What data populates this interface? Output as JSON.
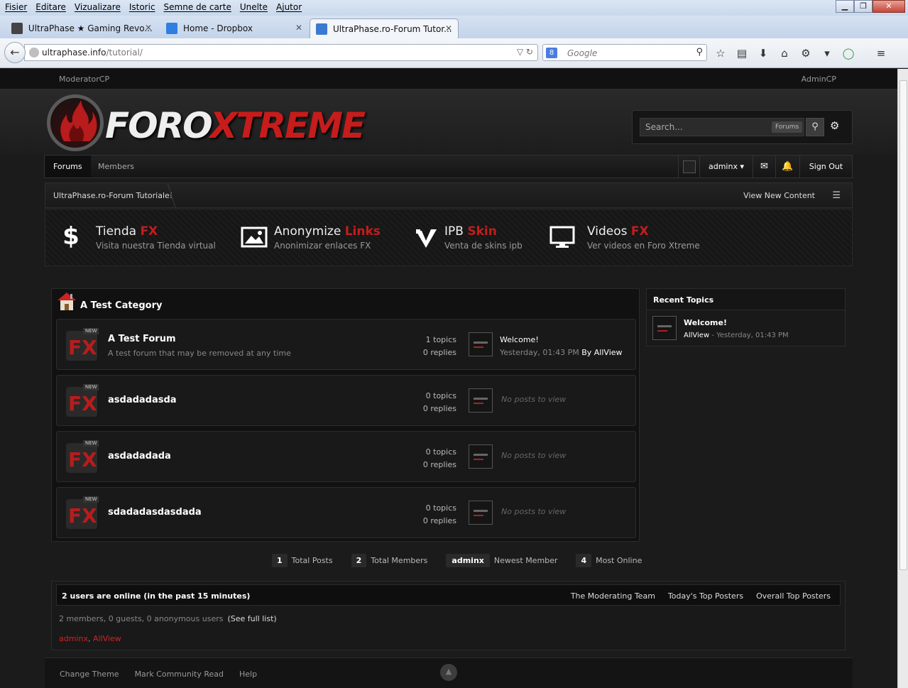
{
  "browser": {
    "menu": [
      "Fisier",
      "Editare",
      "Vizualizare",
      "Istoric",
      "Semne de carte",
      "Unelte",
      "Ajutor"
    ],
    "tabs": [
      {
        "label": "UltraPhase ★ Gaming Revo...",
        "active": false
      },
      {
        "label": "Home - Dropbox",
        "active": false
      },
      {
        "label": "UltraPhase.ro-Forum Tutor...",
        "active": true
      }
    ],
    "url_host": "ultraphase.info",
    "url_path": "/tutorial/",
    "search_placeholder": "Google"
  },
  "site": {
    "top_left": "ModeratorCP",
    "top_right": "AdminCP",
    "logo": {
      "part1": "FORO",
      "part2": "XTREME"
    },
    "search": {
      "placeholder": "Search...",
      "scope": "Forums"
    },
    "nav": {
      "forums": "Forums",
      "members": "Members",
      "username": "adminx",
      "sign_out": "Sign Out"
    },
    "breadcrumb": "UltraPhase.ro-Forum Tutoriale!",
    "view_new_content": "View New Content",
    "promos": [
      {
        "icon": "$",
        "title": "Tienda",
        "accent": "FX",
        "subtitle": "Visita nuestra Tienda virtual"
      },
      {
        "icon": "image",
        "title": "Anonymize",
        "accent": "Links",
        "subtitle": "Anonimizar enlaces FX"
      },
      {
        "icon": "V",
        "title": "IPB",
        "accent": "Skin",
        "subtitle": "Venta de skins ipb"
      },
      {
        "icon": "monitor",
        "title": "Videos",
        "accent": "FX",
        "subtitle": "Ver videos en Foro Xtreme"
      }
    ],
    "category": "A Test Category",
    "forums": [
      {
        "name": "A Test Forum",
        "desc": "A test forum that may be removed at any time",
        "topics": "1 topics",
        "replies": "0 replies",
        "last_title": "Welcome!",
        "last_meta": "Yesterday, 01:43 PM",
        "last_by": "By",
        "last_user": "AllView"
      },
      {
        "name": "asdadadasda",
        "desc": "",
        "topics": "0 topics",
        "replies": "0 replies",
        "no_posts": "No posts to view"
      },
      {
        "name": "asdadadada",
        "desc": "",
        "topics": "0 topics",
        "replies": "0 replies",
        "no_posts": "No posts to view"
      },
      {
        "name": "sdadadasdasdada",
        "desc": "",
        "topics": "0 topics",
        "replies": "0 replies",
        "no_posts": "No posts to view"
      }
    ],
    "fx_badge": "NEW",
    "stats": [
      {
        "n": "1",
        "label": "Total Posts"
      },
      {
        "n": "2",
        "label": "Total Members"
      },
      {
        "n": "adminx",
        "label": "Newest Member"
      },
      {
        "n": "4",
        "label": "Most Online"
      }
    ],
    "recent": {
      "heading": "Recent Topics",
      "title": "Welcome!",
      "user": "AllView",
      "meta": " - Yesterday, 01:43 PM"
    },
    "online": {
      "heading": "2 users are online (in the past 15 minutes)",
      "links": [
        "The Moderating Team",
        "Today's Top Posters",
        "Overall Top Posters"
      ],
      "counts": "2 members, 0 guests, 0 anonymous users",
      "full_list": "(See full list)",
      "users": [
        "adminx",
        "AllView"
      ]
    },
    "footer": [
      "Change Theme",
      "Mark Community Read",
      "Help"
    ],
    "colors": {
      "accent_red": "#c41d1d",
      "bg": "#1b1b1b"
    }
  }
}
